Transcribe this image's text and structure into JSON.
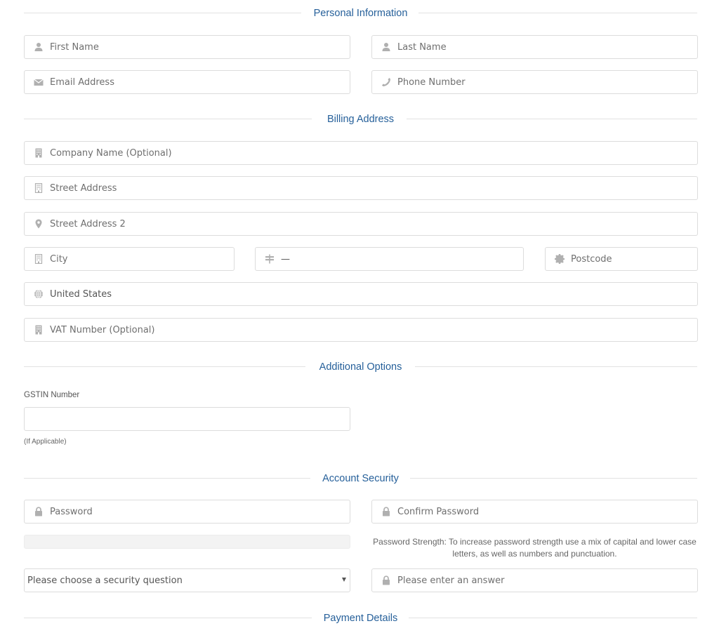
{
  "sections": {
    "personal": "Personal Information",
    "billing": "Billing Address",
    "additional": "Additional Options",
    "security": "Account Security",
    "payment": "Payment Details"
  },
  "personal": {
    "first_name": {
      "placeholder": "First Name",
      "icon": "user-icon"
    },
    "last_name": {
      "placeholder": "Last Name",
      "icon": "user-icon"
    },
    "email": {
      "placeholder": "Email Address",
      "icon": "envelope-icon"
    },
    "phone": {
      "placeholder": "Phone Number",
      "icon": "phone-icon"
    }
  },
  "billing": {
    "company": {
      "placeholder": "Company Name (Optional)",
      "icon": "building-icon"
    },
    "street1": {
      "placeholder": "Street Address",
      "icon": "building-outline-icon"
    },
    "street2": {
      "placeholder": "Street Address 2",
      "icon": "map-marker-icon"
    },
    "city": {
      "placeholder": "City",
      "icon": "building-outline-icon"
    },
    "state": {
      "value": "—",
      "icon": "signpost-icon"
    },
    "postcode": {
      "placeholder": "Postcode",
      "icon": "certificate-icon"
    },
    "country": {
      "value": "United States",
      "icon": "globe-icon"
    },
    "vat": {
      "placeholder": "VAT Number (Optional)",
      "icon": "building-icon"
    }
  },
  "additional": {
    "gstin_label": "GSTIN Number",
    "gstin_value": "",
    "gstin_help": "(If Applicable)"
  },
  "security": {
    "password": {
      "placeholder": "Password",
      "icon": "lock-icon"
    },
    "confirm_password": {
      "placeholder": "Confirm Password",
      "icon": "lock-icon"
    },
    "strength_percent": 0,
    "strength_text": "Password Strength: To increase password strength use a mix of capital and lower case letters, as well as numbers and punctuation.",
    "question": {
      "selected": "Please choose a security question"
    },
    "answer": {
      "placeholder": "Please enter an answer",
      "icon": "lock-icon"
    }
  },
  "colors": {
    "section_title": "#26609a",
    "border": "#dcdcdc",
    "icon": "#b0b0b0"
  }
}
